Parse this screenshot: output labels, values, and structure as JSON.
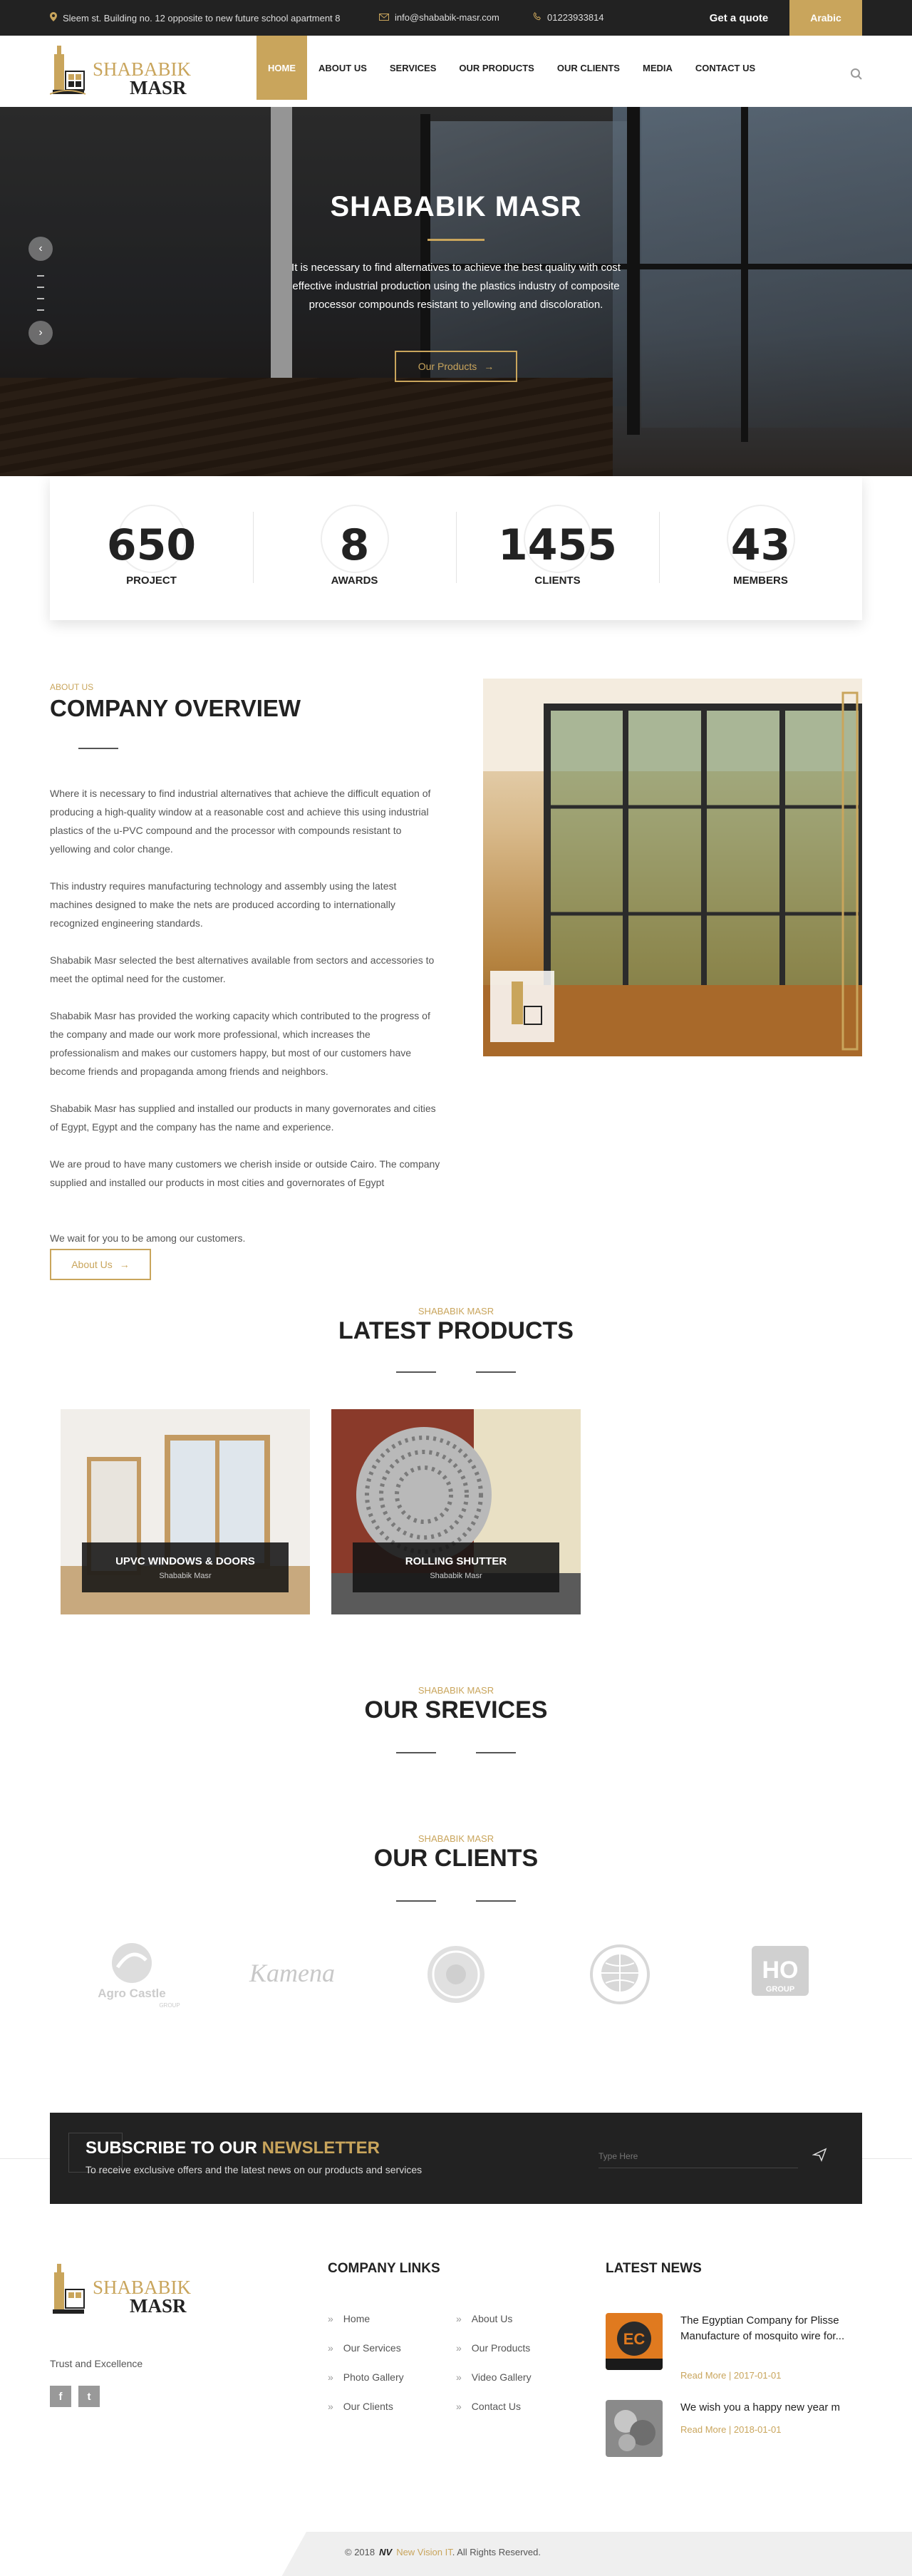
{
  "topbar": {
    "address": "Sleem st. Building no. 12 opposite to new future school apartment 8",
    "email": "info@shababik-masr.com",
    "phone": "01223933814",
    "quote_label": "Get a quote",
    "language_label": "Arabic"
  },
  "header": {
    "logo_line1": "SHABABIK",
    "logo_line2": "MASR",
    "nav": [
      {
        "label": "HOME",
        "active": true
      },
      {
        "label": "ABOUT US"
      },
      {
        "label": "SERVICES"
      },
      {
        "label": "OUR PRODUCTS"
      },
      {
        "label": "OUR CLIENTS"
      },
      {
        "label": "MEDIA"
      },
      {
        "label": "CONTACT US"
      }
    ]
  },
  "hero": {
    "title": "SHABABIK MASR",
    "text": "It is necessary to find alternatives to achieve the best quality with cost effective industrial production using the plastics industry of composite processor compounds resistant to yellowing and discoloration.",
    "button_label": "Our Products"
  },
  "stats": [
    {
      "value": "650",
      "label": "PROJECT"
    },
    {
      "value": "8",
      "label": "AWARDS"
    },
    {
      "value": "1455",
      "label": "CLIENTS"
    },
    {
      "value": "43",
      "label": "MEMBERS"
    }
  ],
  "about": {
    "kicker": "ABOUT US",
    "title": "COMPANY OVERVIEW",
    "paragraphs": [
      "Where it is necessary to find industrial alternatives that achieve the difficult equation of producing a high-quality window at a reasonable cost and achieve this using industrial plastics of the u-PVC compound and the processor with compounds resistant to yellowing and color change.",
      "This industry requires manufacturing technology and assembly using the latest machines designed to make the nets are produced according to internationally recognized engineering standards.",
      "Shababik Masr selected the best alternatives available from sectors and accessories to meet the optimal need for the customer.",
      "Shababik Masr has provided the working capacity which contributed to the progress of the company and made our work more professional, which increases the professionalism and makes our customers happy, but most of our customers have become friends and propaganda among friends and neighbors.",
      "Shababik Masr  has supplied and installed our products in many governorates and cities of Egypt, Egypt and the company has the name and experience.",
      "We are proud to have many customers we cherish inside or outside Cairo. The company supplied and installed our products in most cities and governorates of Egypt",
      "We wait for you to be among our customers."
    ],
    "button_label": "About Us"
  },
  "products": {
    "kicker": "SHABABIK MASR",
    "title": "LATEST PRODUCTS",
    "items": [
      {
        "title": "UPVC WINDOWS & DOORS",
        "subtitle": "Shababik Masr"
      },
      {
        "title": "ROLLING SHUTTER",
        "subtitle": "Shababik Masr"
      }
    ]
  },
  "services": {
    "kicker": "SHABABIK MASR",
    "title": "OUR SREVICES"
  },
  "clients": {
    "kicker": "SHABABIK MASR",
    "title": "OUR CLIENTS",
    "logos": [
      {
        "name": "Agro Castle",
        "sub": "GROUP"
      },
      {
        "name": "Kamena"
      },
      {
        "name": "seal-logo"
      },
      {
        "name": "globe-logo"
      },
      {
        "name": "HO",
        "sub": "GROUP"
      }
    ]
  },
  "newsletter": {
    "title_plain": "SUBSCRIBE TO OUR ",
    "title_accent": "NEWSLETTER",
    "subtitle": "To receive exclusive offers and the latest news on our products and services",
    "placeholder": "Type Here"
  },
  "footer": {
    "tagline": "Trust and Excellence",
    "links_title": "COMPANY LINKS",
    "links_left": [
      "Home",
      "Our Services",
      "Photo Gallery",
      "Our Clients"
    ],
    "links_right": [
      "About Us",
      "Our Products",
      "Video Gallery",
      "Contact Us"
    ],
    "news_title": "LATEST NEWS",
    "news": [
      {
        "title": "The Egyptian Company for Plisse Manufacture of mosquito wire for...",
        "read_more": "Read More",
        "date": "2017-01-01"
      },
      {
        "title": "We wish you a happy new year m",
        "read_more": "Read More",
        "date": "2018-01-01"
      }
    ],
    "copyright_prefix": "© 2018",
    "copyright_brand": "New Vision IT",
    "copyright_suffix": ". All Rights Reserved."
  },
  "colors": {
    "accent": "#c9a55c",
    "dark": "#222222"
  }
}
